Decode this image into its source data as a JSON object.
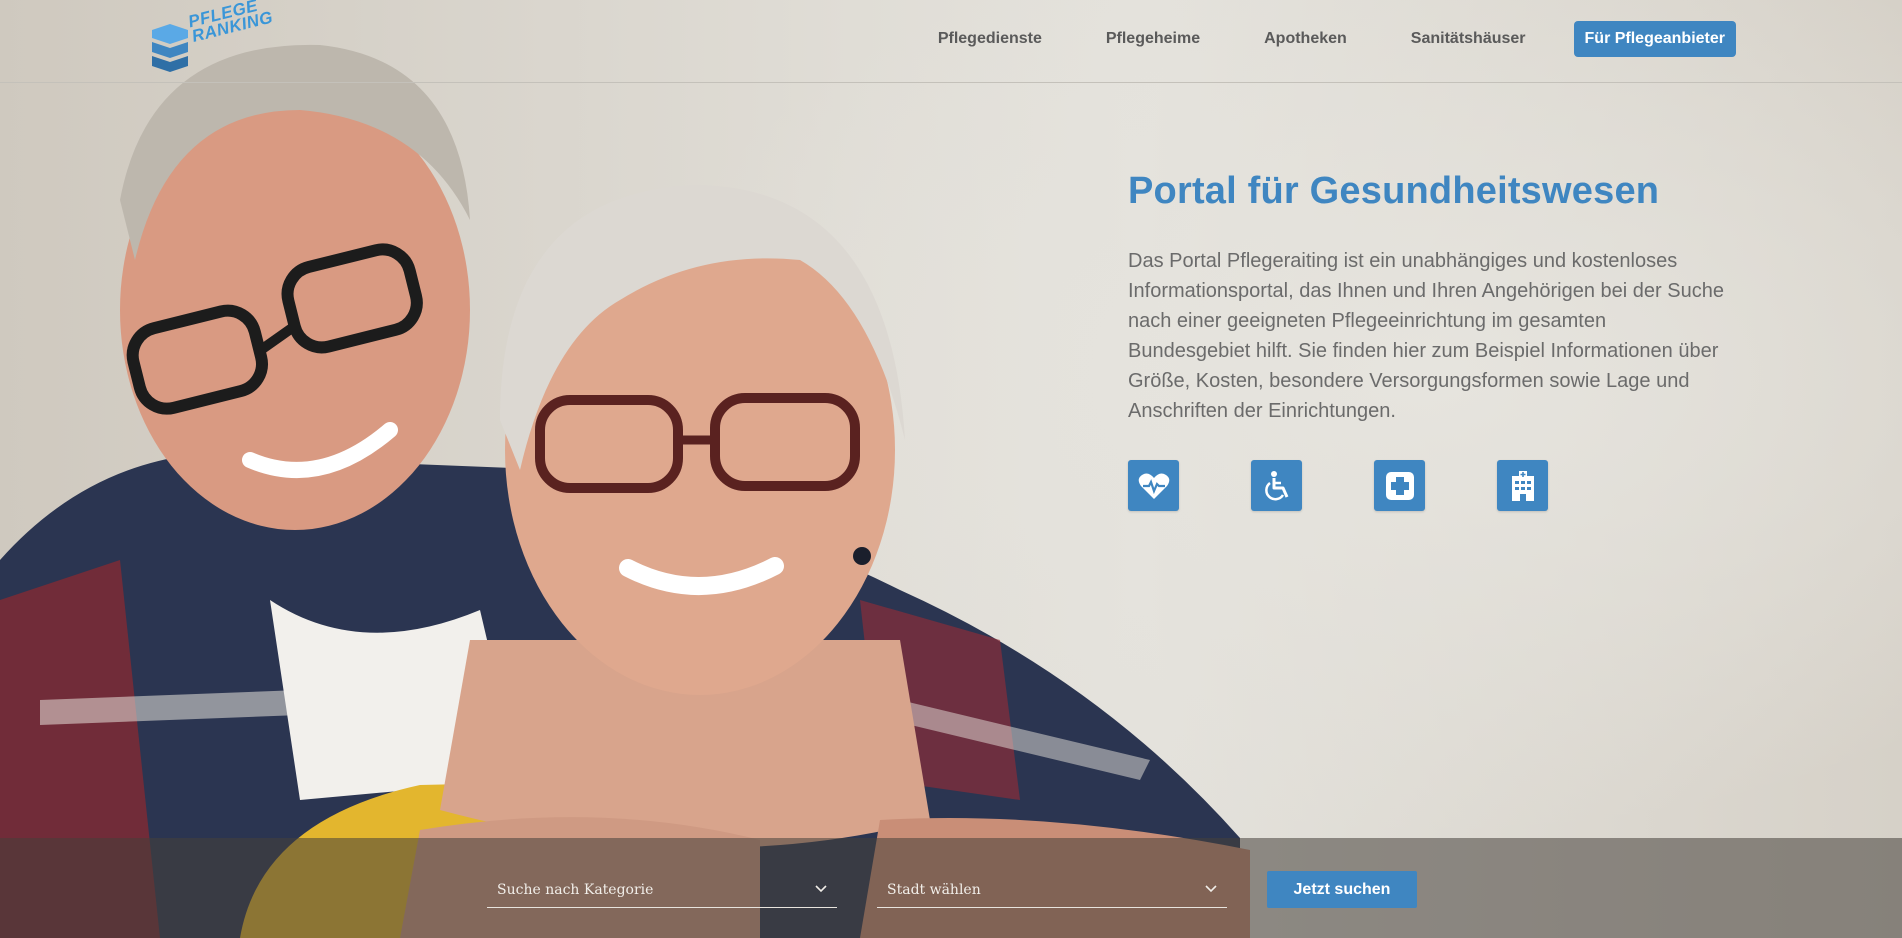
{
  "header": {
    "logo_line1": "PFLEGE",
    "logo_line2": "RANKING",
    "nav": [
      {
        "label": "Pflegedienste"
      },
      {
        "label": "Pflegeheime"
      },
      {
        "label": "Apotheken"
      },
      {
        "label": "Sanitätshäuser"
      }
    ],
    "cta_label": "Für Pflegeanbieter"
  },
  "intro": {
    "title": "Portal für Gesundheitswesen",
    "text": "Das Portal Pflegeraiting ist ein unabhängiges und kostenloses Informationsportal, das Ihnen und Ihren Angehörigen bei der Suche nach einer geeigneten Pflegeeinrichtung im gesamten Bundesgebiet hilft. Sie finden hier zum Beispiel Informationen über Größe, Kosten, besondere Versorgungsformen sowie Lage und Anschriften der Einrichtungen.",
    "icons": [
      "heartbeat-icon",
      "wheelchair-icon",
      "medical-cross-icon",
      "hospital-building-icon"
    ]
  },
  "search": {
    "category_label": "Suche nach Kategorie",
    "city_label": "Stadt wählen",
    "button_label": "Jetzt suchen"
  },
  "colors": {
    "accent": "#3f86c1",
    "logo": "#3a96d8",
    "text": "#6b6b6b"
  }
}
